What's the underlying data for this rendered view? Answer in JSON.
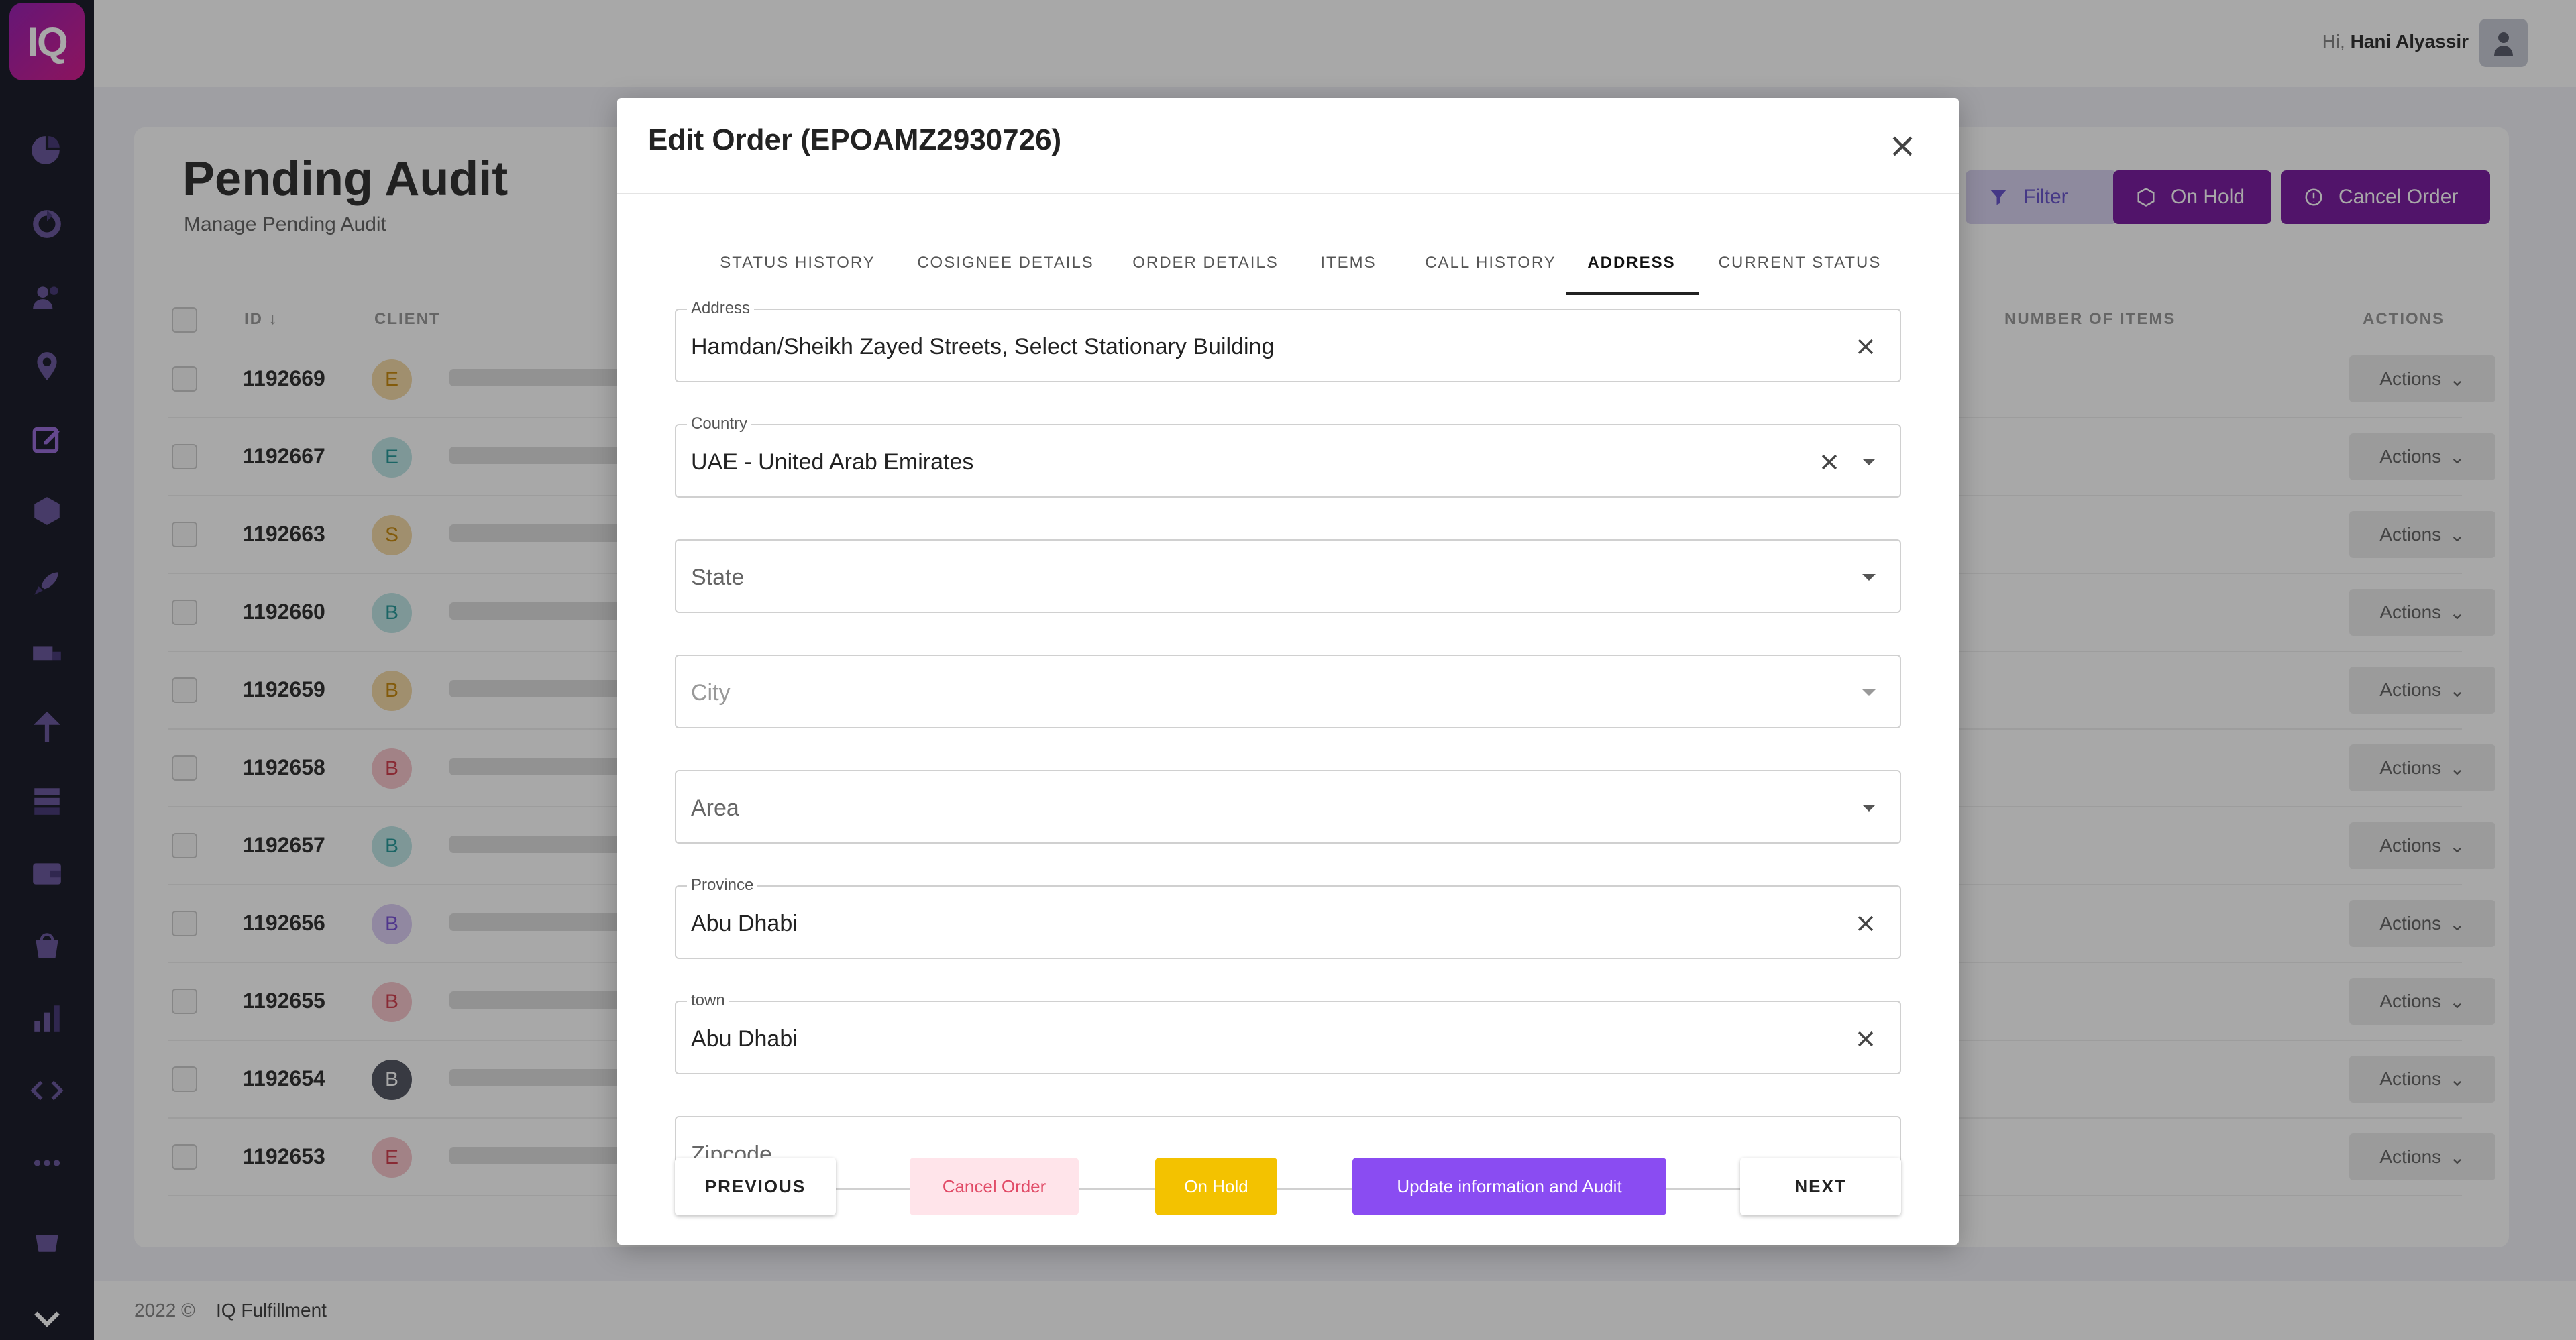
{
  "app": {
    "logo": "IQ",
    "greeting": "Hi,",
    "user_name": "Hani Alyassir"
  },
  "sidebar": {
    "icons": [
      "pie-chart-icon",
      "refresh-icon",
      "users-icon",
      "location-pin-icon",
      "edit-icon",
      "box-icon",
      "rocket-icon",
      "truck-icon",
      "pin-icon",
      "server-icon",
      "wallet-icon",
      "store-icon",
      "bar-chart-icon",
      "code-icon",
      "more-icon",
      "shop-icon",
      "chevron-down-icon"
    ]
  },
  "page": {
    "title": "Pending Audit",
    "subtitle": "Manage Pending Audit",
    "buttons": {
      "filter": "Filter",
      "on_hold": "On Hold",
      "cancel_order": "Cancel Order"
    },
    "table": {
      "headers": {
        "id": "ID",
        "client": "CLIENT",
        "items": "NUMBER OF ITEMS",
        "actions": "ACTIONS"
      },
      "action_label": "Actions",
      "rows": [
        {
          "id": "1192669",
          "initial": "E",
          "color": "#f3d9a8",
          "fg": "#c78a12"
        },
        {
          "id": "1192667",
          "initial": "E",
          "color": "#bfe6e6",
          "fg": "#2a9a9a"
        },
        {
          "id": "1192663",
          "initial": "S",
          "color": "#f3d9a8",
          "fg": "#c78a12"
        },
        {
          "id": "1192660",
          "initial": "B",
          "color": "#bfe6e6",
          "fg": "#2a9a9a"
        },
        {
          "id": "1192659",
          "initial": "B",
          "color": "#f3d9a8",
          "fg": "#c78a12"
        },
        {
          "id": "1192658",
          "initial": "B",
          "color": "#f6c6cc",
          "fg": "#d1404f"
        },
        {
          "id": "1192657",
          "initial": "B",
          "color": "#bfe6e6",
          "fg": "#2a9a9a"
        },
        {
          "id": "1192656",
          "initial": "B",
          "color": "#dccff5",
          "fg": "#7a52d6"
        },
        {
          "id": "1192655",
          "initial": "B",
          "color": "#f6c6cc",
          "fg": "#d1404f"
        },
        {
          "id": "1192654",
          "initial": "B",
          "color": "#555865",
          "fg": "#ffffff"
        },
        {
          "id": "1192653",
          "initial": "E",
          "color": "#f6c6cc",
          "fg": "#d1404f"
        }
      ]
    }
  },
  "footer": {
    "year": "2022 ©",
    "company": "IQ Fulfillment"
  },
  "modal": {
    "title": "Edit Order (EPOAMZ2930726)",
    "tabs": [
      "STATUS HISTORY",
      "COSIGNEE DETAILS",
      "ORDER DETAILS",
      "ITEMS",
      "CALL HISTORY",
      "ADDRESS",
      "CURRENT STATUS"
    ],
    "active_tab": "ADDRESS",
    "fields": {
      "address": {
        "label": "Address",
        "value": "Hamdan/Sheikh Zayed Streets, Select Stationary Building"
      },
      "country": {
        "label": "Country",
        "value": "UAE - United Arab Emirates"
      },
      "state": {
        "placeholder": "State"
      },
      "city": {
        "placeholder": "City"
      },
      "area": {
        "placeholder": "Area"
      },
      "province": {
        "label": "Province",
        "value": "Abu Dhabi"
      },
      "town": {
        "label": "town",
        "value": "Abu Dhabi"
      },
      "zipcode": {
        "placeholder": "Zipcode"
      }
    },
    "buttons": {
      "previous": "PREVIOUS",
      "cancel_order": "Cancel Order",
      "on_hold": "On Hold",
      "update_audit": "Update information and Audit",
      "next": "NEXT"
    }
  }
}
